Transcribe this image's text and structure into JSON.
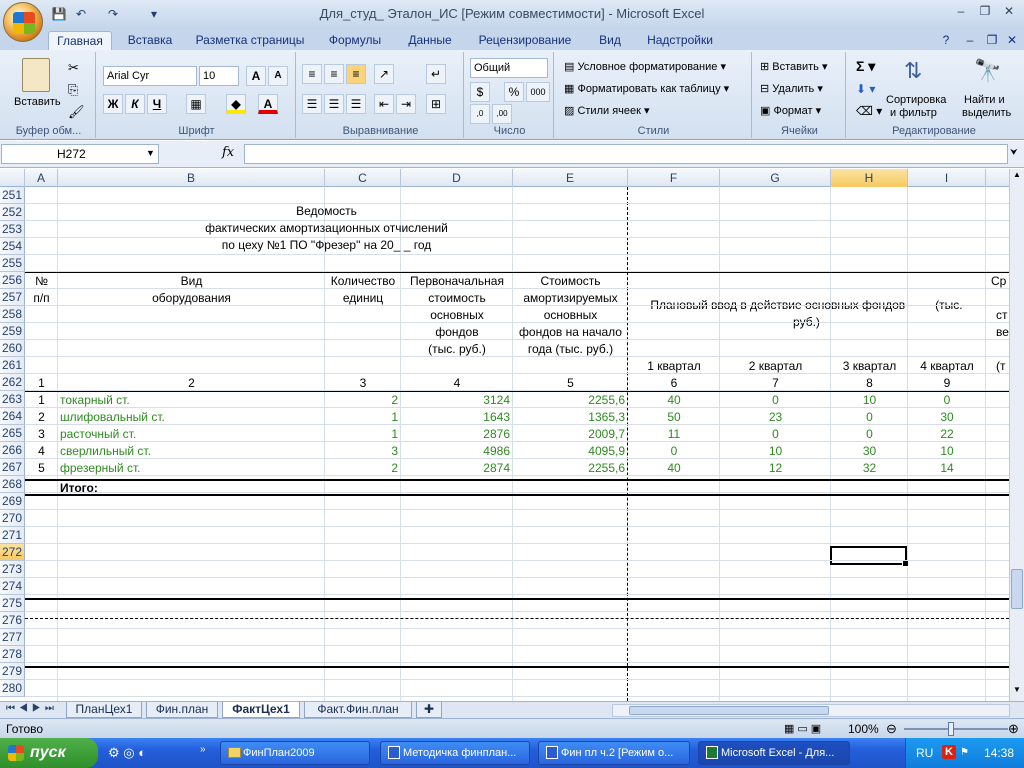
{
  "window": {
    "title": "Для_студ_ Эталон_ИС  [Режим совместимости] - Microsoft Excel",
    "min": "–",
    "restore": "❐",
    "close": "✕"
  },
  "tabs": [
    "Главная",
    "Вставка",
    "Разметка страницы",
    "Формулы",
    "Данные",
    "Рецензирование",
    "Вид",
    "Надстройки"
  ],
  "ribbon": {
    "clipboard": {
      "paste": "Вставить",
      "label": "Буфер обм..."
    },
    "font": {
      "name": "Arial Cyr",
      "size": "10",
      "bold": "Ж",
      "italic": "К",
      "underline": "Ч",
      "label": "Шрифт"
    },
    "alignment": {
      "label": "Выравнивание"
    },
    "number": {
      "format": "Общий",
      "percent": "%",
      "thousands": "000",
      "label": "Число"
    },
    "styles": {
      "conditional": "Условное форматирование",
      "as_table": "Форматировать как таблицу",
      "cell_styles": "Стили ячеек",
      "label": "Стили"
    },
    "cells": {
      "insert": "Вставить",
      "delete": "Удалить",
      "format": "Формат",
      "label": "Ячейки"
    },
    "editing": {
      "sort": "Сортировка",
      "sort2": "и фильтр",
      "find": "Найти и",
      "find2": "выделить",
      "label": "Редактирование"
    }
  },
  "formula_bar": {
    "name_box": "H272",
    "fx": "fx",
    "value": ""
  },
  "columns": [
    "A",
    "B",
    "C",
    "D",
    "E",
    "F",
    "G",
    "H",
    "I"
  ],
  "rows": [
    "251",
    "252",
    "253",
    "254",
    "255",
    "256",
    "257",
    "258",
    "259",
    "260",
    "261",
    "262",
    "263",
    "264",
    "265",
    "266",
    "267",
    "268",
    "269",
    "270",
    "271",
    "272",
    "273",
    "274",
    "275",
    "276",
    "277",
    "278",
    "279",
    "280"
  ],
  "sheet": {
    "title1": "Ведомость",
    "title2": "фактических амортизационных отчислений",
    "title3": "по цеху №1 ПО \"Фрезер\" на 20_ _  год",
    "h_num1": "№",
    "h_num2": "п/п",
    "h_vid1": "Вид",
    "h_vid2": "оборудования",
    "h_qty1": "Количество",
    "h_qty2": "единиц",
    "h_init1": "Первоначальная",
    "h_init2": "стоимость",
    "h_init3": "основных",
    "h_init4": "фондов",
    "h_init5": "(тыс. руб.)",
    "h_cost1": "Стоимость",
    "h_cost2": "амортизируемых",
    "h_cost3": "основных",
    "h_cost4": "фондов на начало",
    "h_cost5": "года (тыс. руб.)",
    "h_plan1": "Плановый ввод в действие основных фондов         (тыс.",
    "h_plan2": "руб.)",
    "q1": "1 квартал",
    "q2": "2 квартал",
    "q3": "3 квартал",
    "q4": "4 квартал",
    "h_j1": "Ср",
    "h_j2": "ст",
    "h_j3": "ве",
    "h_j4": "(т",
    "nums": [
      "1",
      "2",
      "3",
      "4",
      "5",
      "6",
      "7",
      "8",
      "9"
    ],
    "data": [
      {
        "n": "1",
        "name": "токарный ст.",
        "qty": "2",
        "init": "3124",
        "cost": "2255,6",
        "q1": "40",
        "q2": "0",
        "q3": "10",
        "q4": "0"
      },
      {
        "n": "2",
        "name": "шлифовальный ст.",
        "qty": "1",
        "init": "1643",
        "cost": "1365,3",
        "q1": "50",
        "q2": "23",
        "q3": "0",
        "q4": "30"
      },
      {
        "n": "3",
        "name": "расточный ст.",
        "qty": "1",
        "init": "2876",
        "cost": "2009,7",
        "q1": "11",
        "q2": "0",
        "q3": "0",
        "q4": "22"
      },
      {
        "n": "4",
        "name": "сверлильный ст.",
        "qty": "3",
        "init": "4986",
        "cost": "4095,9",
        "q1": "0",
        "q2": "10",
        "q3": "30",
        "q4": "10"
      },
      {
        "n": "5",
        "name": "фрезерный ст.",
        "qty": "2",
        "init": "2874",
        "cost": "2255,6",
        "q1": "40",
        "q2": "12",
        "q3": "32",
        "q4": "14"
      }
    ],
    "total": "Итого:"
  },
  "sheet_tabs": [
    "ПланЦех1",
    "Фин.план",
    "ФактЦех1",
    "Факт.Фин.план"
  ],
  "status": {
    "ready": "Готово",
    "zoom": "100%"
  },
  "taskbar": {
    "start": "пуск",
    "tasks": [
      "ФинПлан2009",
      "Методичка финплан...",
      "Фин пл ч.2 [Режим о...",
      "Microsoft Excel - Для..."
    ],
    "lang": "RU",
    "clock": "14:38"
  },
  "colors": {
    "green_text": "#2e8b1f",
    "selection": "#f7c960",
    "ribbon": "#d3e0f0"
  }
}
